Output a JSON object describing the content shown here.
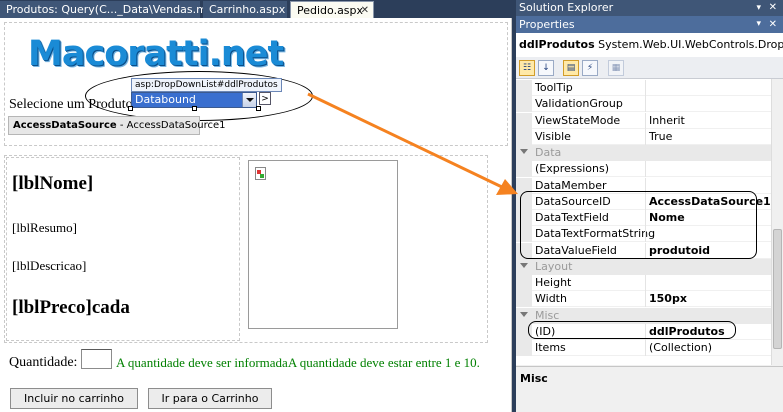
{
  "tabs": [
    {
      "label": "Produtos: Query(C..._Data\\Vendas.mdb)"
    },
    {
      "label": "Carrinho.aspx"
    },
    {
      "label": "Pedido.aspx"
    }
  ],
  "designer": {
    "logo": "Macoratti.net",
    "select_label": "Selecione um Produto:",
    "ddl_tag": "asp:DropDownList#ddlProdutos",
    "ddl_value": "Databound",
    "smart_tag": ">",
    "datasource_label": "AccessDataSource",
    "datasource_id": " - AccessDataSource1",
    "lbl_nome": "[lblNome]",
    "lbl_resumo": "[lblResumo]",
    "lbl_descricao": "[lblDescricao]",
    "lbl_preco": "[lblPreco]cada",
    "quantidade_label": "Quantidade:",
    "validation_text": "A quantidade deve ser informadaA quantidade deve estar entre 1 e 10.",
    "btn_incluir": "Incluir no carrinho",
    "btn_ir": "Ir para o Carrinho"
  },
  "solution_explorer": {
    "title": "Solution Explorer"
  },
  "properties": {
    "title": "Properties",
    "object_name": "ddlProdutos",
    "object_type": " System.Web.UI.WebControls.DropDownLis",
    "rows": [
      {
        "kind": "prop",
        "name": "ToolTip",
        "value": "",
        "bold": false
      },
      {
        "kind": "prop",
        "name": "ValidationGroup",
        "value": "",
        "bold": false
      },
      {
        "kind": "prop",
        "name": "ViewStateMode",
        "value": "Inherit",
        "bold": false
      },
      {
        "kind": "prop",
        "name": "Visible",
        "value": "True",
        "bold": false
      },
      {
        "kind": "cat",
        "name": "Data"
      },
      {
        "kind": "prop",
        "name": "(Expressions)",
        "value": "",
        "bold": false
      },
      {
        "kind": "prop",
        "name": "DataMember",
        "value": "",
        "bold": false
      },
      {
        "kind": "prop",
        "name": "DataSourceID",
        "value": "AccessDataSource1",
        "bold": true
      },
      {
        "kind": "prop",
        "name": "DataTextField",
        "value": "Nome",
        "bold": true
      },
      {
        "kind": "prop",
        "name": "DataTextFormatString",
        "value": "",
        "bold": false
      },
      {
        "kind": "prop",
        "name": "DataValueField",
        "value": "produtoid",
        "bold": true
      },
      {
        "kind": "cat",
        "name": "Layout"
      },
      {
        "kind": "prop",
        "name": "Height",
        "value": "",
        "bold": false
      },
      {
        "kind": "prop",
        "name": "Width",
        "value": "150px",
        "bold": true
      },
      {
        "kind": "cat",
        "name": "Misc"
      },
      {
        "kind": "prop",
        "name": "(ID)",
        "value": "ddlProdutos",
        "bold": true
      },
      {
        "kind": "prop",
        "name": "Items",
        "value": "(Collection)",
        "bold": false
      }
    ],
    "description_title": "Misc"
  },
  "colors": {
    "arrow": "#f58220",
    "tab_bar": "#2c3e5a",
    "validation": "#008000",
    "logo": "#1a8bd6"
  }
}
